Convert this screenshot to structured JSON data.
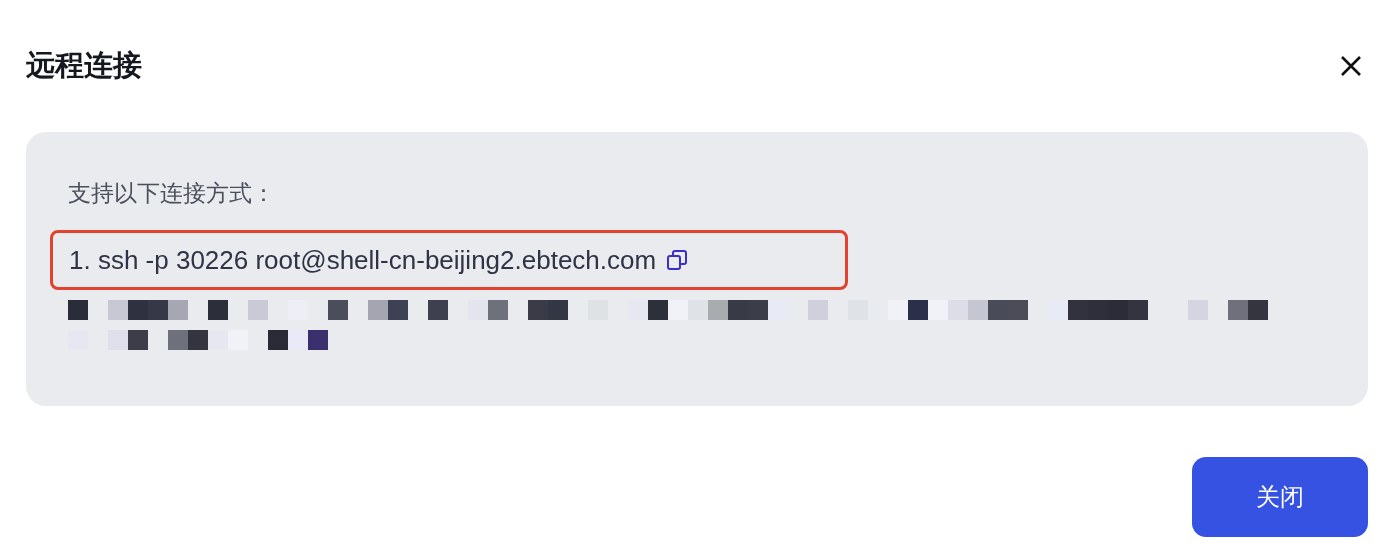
{
  "dialog": {
    "title": "远程连接",
    "intro": "支持以下连接方式：",
    "commands": [
      {
        "text": "1. ssh -p 30226 root@shell-cn-beijing2.ebtech.com",
        "highlighted": true
      }
    ],
    "buttons": [
      "关闭"
    ]
  }
}
